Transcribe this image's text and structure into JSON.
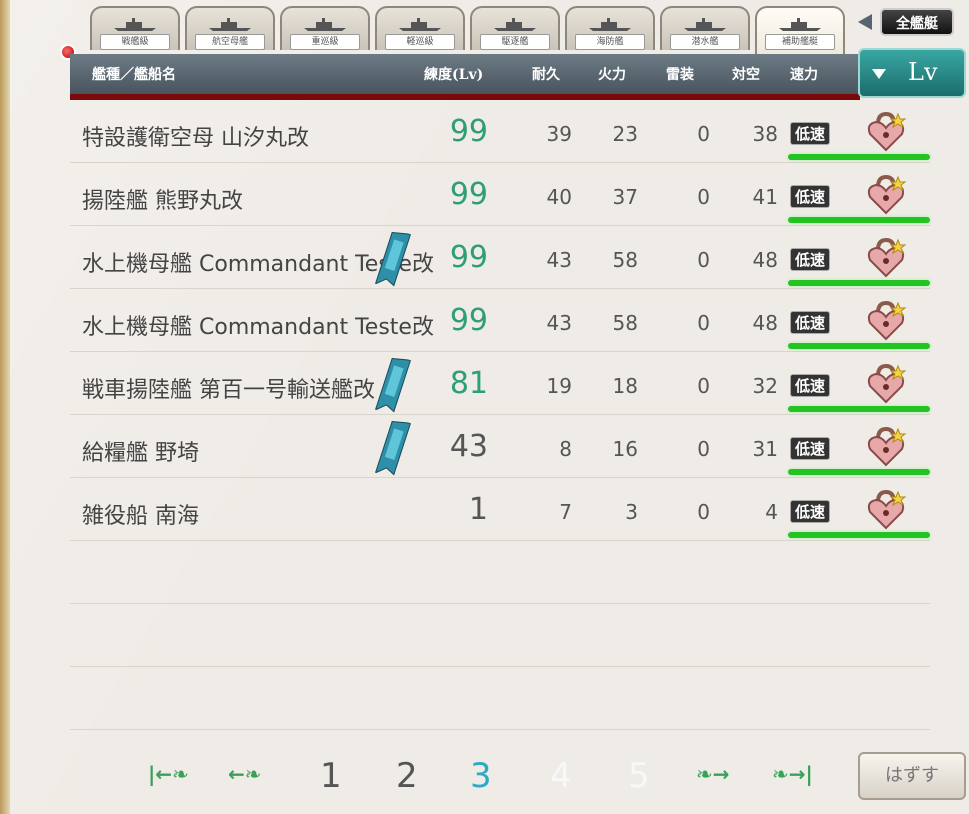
{
  "tabs": [
    {
      "label": "戦艦級",
      "active": false
    },
    {
      "label": "航空母艦",
      "active": false
    },
    {
      "label": "重巡級",
      "active": false
    },
    {
      "label": "軽巡級",
      "active": false
    },
    {
      "label": "駆逐艦",
      "active": false
    },
    {
      "label": "海防艦",
      "active": false
    },
    {
      "label": "潜水艦",
      "active": false
    },
    {
      "label": "補助艦艇",
      "active": true
    }
  ],
  "all_ships_label": "全艦艇",
  "header": {
    "name": "艦種／艦船名",
    "lv": "練度(Lv)",
    "hp": "耐久",
    "fp": "火力",
    "tp": "雷装",
    "aa": "対空",
    "speed": "速力"
  },
  "sort_label": "Lv",
  "rows": [
    {
      "name": "特設護衛空母 山汐丸改",
      "lv": "99",
      "hp": "39",
      "fp": "23",
      "tp": "0",
      "aa": "38",
      "speed": "低速",
      "high": true,
      "banner": false
    },
    {
      "name": "揚陸艦 熊野丸改",
      "lv": "99",
      "hp": "40",
      "fp": "37",
      "tp": "0",
      "aa": "41",
      "speed": "低速",
      "high": true,
      "banner": false
    },
    {
      "name": "水上機母艦 Commandant Teste改",
      "lv": "99",
      "hp": "43",
      "fp": "58",
      "tp": "0",
      "aa": "48",
      "speed": "低速",
      "high": true,
      "banner": true
    },
    {
      "name": "水上機母艦 Commandant Teste改",
      "lv": "99",
      "hp": "43",
      "fp": "58",
      "tp": "0",
      "aa": "48",
      "speed": "低速",
      "high": true,
      "banner": false
    },
    {
      "name": "戦車揚陸艦 第百一号輸送艦改",
      "lv": "81",
      "hp": "19",
      "fp": "18",
      "tp": "0",
      "aa": "32",
      "speed": "低速",
      "high": true,
      "banner": true
    },
    {
      "name": "給糧艦 野埼",
      "lv": "43",
      "hp": "8",
      "fp": "16",
      "tp": "0",
      "aa": "31",
      "speed": "低速",
      "high": false,
      "banner": true
    },
    {
      "name": "雑役船 南海",
      "lv": "1",
      "hp": "7",
      "fp": "3",
      "tp": "0",
      "aa": "4",
      "speed": "低速",
      "high": false,
      "banner": false
    }
  ],
  "pager": {
    "pages": [
      {
        "label": "1",
        "state": "normal"
      },
      {
        "label": "2",
        "state": "normal"
      },
      {
        "label": "3",
        "state": "current"
      },
      {
        "label": "4",
        "state": "disabled"
      },
      {
        "label": "5",
        "state": "disabled"
      }
    ]
  },
  "remove_label": "はずす"
}
